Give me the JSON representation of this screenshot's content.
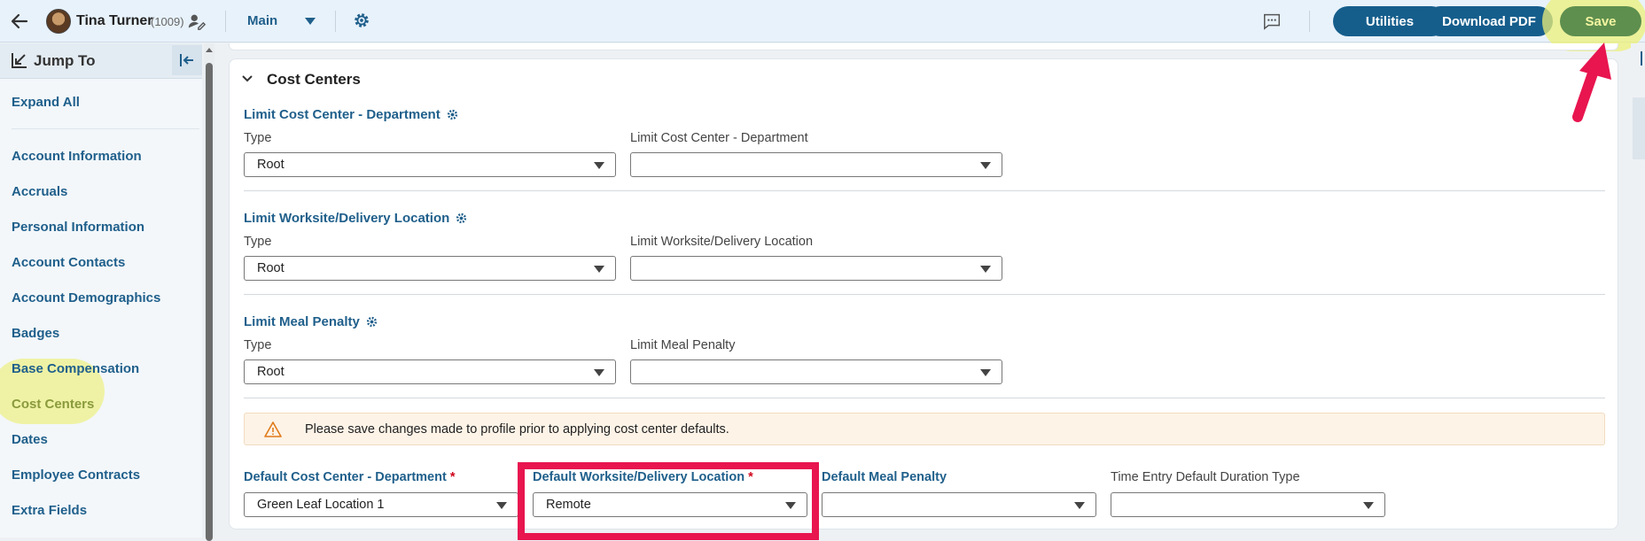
{
  "header": {
    "user_name": "Tina Turner",
    "user_id": "(1009)",
    "view": "Main",
    "buttons": {
      "utilities": "Utilities",
      "download_pdf": "Download PDF",
      "save": "Save"
    }
  },
  "sidebar": {
    "title": "Jump To",
    "expand_all": "Expand All",
    "items": [
      "Account Information",
      "Accruals",
      "Personal Information",
      "Account Contacts",
      "Account Demographics",
      "Badges",
      "Base Compensation",
      "Cost Centers",
      "Dates",
      "Employee Contracts",
      "Extra Fields"
    ],
    "active_item": "Cost Centers"
  },
  "section": {
    "title": "Cost Centers",
    "groups": [
      {
        "title": "Limit Cost Center - Department",
        "type_label": "Type",
        "type_value": "Root",
        "limit_label": "Limit Cost Center - Department",
        "limit_value": ""
      },
      {
        "title": "Limit Worksite/Delivery Location",
        "type_label": "Type",
        "type_value": "Root",
        "limit_label": "Limit Worksite/Delivery Location",
        "limit_value": ""
      },
      {
        "title": "Limit Meal Penalty",
        "type_label": "Type",
        "type_value": "Root",
        "limit_label": "Limit Meal Penalty",
        "limit_value": ""
      }
    ],
    "warning": "Please save changes made to profile prior to applying cost center defaults.",
    "defaults": {
      "cost_center_label": "Default Cost Center - Department",
      "cost_center_value": "Green Leaf Location 1",
      "worksite_label": "Default Worksite/Delivery Location",
      "worksite_value": "Remote",
      "meal_label": "Default Meal Penalty",
      "meal_value": "",
      "duration_label": "Time Entry Default Duration Type",
      "duration_value": "",
      "required_mark": "*"
    }
  },
  "colors": {
    "accent": "#1f5f8b",
    "save_button": "#5e8f4f",
    "highlight_box": "#e8154f",
    "highlight_glow": "#ecf078"
  }
}
